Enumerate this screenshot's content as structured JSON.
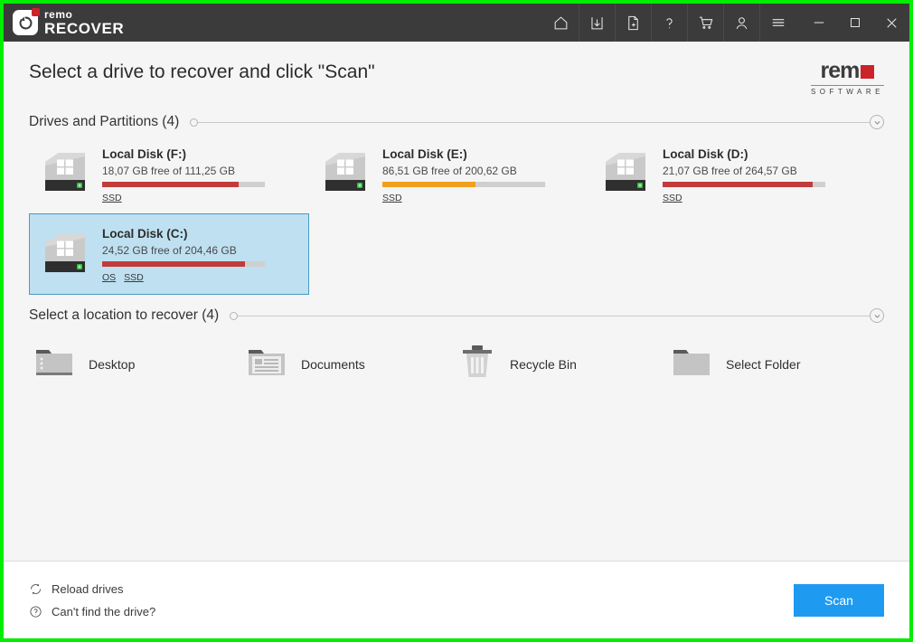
{
  "titlebar": {
    "brand_top": "remo",
    "brand_bottom": "RECOVER",
    "icons": [
      {
        "name": "home-icon",
        "label": "Home"
      },
      {
        "name": "save-icon",
        "label": "Save recovery session"
      },
      {
        "name": "new-file-icon",
        "label": "New session"
      },
      {
        "name": "help-icon",
        "label": "Help"
      },
      {
        "name": "cart-icon",
        "label": "Buy now"
      },
      {
        "name": "user-icon",
        "label": "Account"
      },
      {
        "name": "menu-icon",
        "label": "Menu"
      },
      {
        "name": "minimize-icon",
        "label": "Minimize"
      },
      {
        "name": "maximize-icon",
        "label": "Maximize"
      },
      {
        "name": "close-icon",
        "label": "Close"
      }
    ]
  },
  "header": {
    "page_title": "Select a drive to recover and click \"Scan\"",
    "logo_text": "rem",
    "logo_sub": "SOFTWARE"
  },
  "drives_section": {
    "title": "Drives and Partitions (4)"
  },
  "drives": [
    {
      "name": "Local Disk (F:)",
      "free": "18,07 GB free of 111,25 GB",
      "used_percent": 84,
      "bar_color": "#c23b3b",
      "badges": [
        "SSD"
      ],
      "selected": false
    },
    {
      "name": "Local Disk (E:)",
      "free": "86,51 GB free of 200,62 GB",
      "used_percent": 57,
      "bar_color": "#f0a01e",
      "badges": [
        "SSD"
      ],
      "selected": false
    },
    {
      "name": "Local Disk (D:)",
      "free": "21,07 GB free of 264,57 GB",
      "used_percent": 92,
      "bar_color": "#c23b3b",
      "badges": [
        "SSD"
      ],
      "selected": false
    },
    {
      "name": "Local Disk (C:)",
      "free": "24,52 GB free of 204,46 GB",
      "used_percent": 88,
      "bar_color": "#c23b3b",
      "badges": [
        "OS",
        "SSD"
      ],
      "selected": true
    }
  ],
  "locations_section": {
    "title": "Select a location to recover (4)"
  },
  "locations": [
    {
      "label": "Desktop",
      "icon": "desktop-folder-icon"
    },
    {
      "label": "Documents",
      "icon": "documents-folder-icon"
    },
    {
      "label": "Recycle Bin",
      "icon": "recycle-bin-icon"
    },
    {
      "label": "Select Folder",
      "icon": "folder-icon"
    }
  ],
  "footer": {
    "reload_label": "Reload drives",
    "cant_find_label": "Can't find the drive?",
    "scan_label": "Scan"
  },
  "colors": {
    "window_border": "#00ee00",
    "titlebar": "#3b3b3b",
    "accent_blue": "#1e9bf0",
    "brand_red": "#cc2229",
    "selection_bg": "#bfe0f0",
    "selection_border": "#4a9ac4"
  }
}
